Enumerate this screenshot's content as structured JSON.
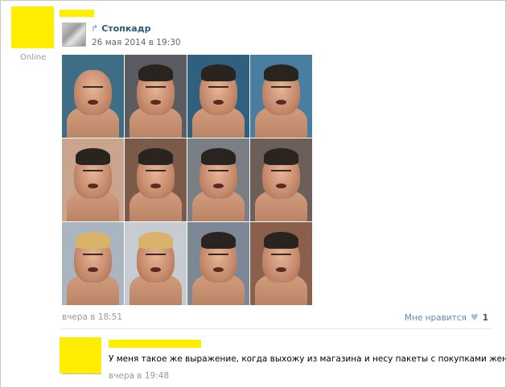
{
  "post": {
    "status": "Online",
    "repost": {
      "source_name": "Стопкадр",
      "date": "26 мая 2014 в 19:30",
      "icon": "repost-arrow-icon"
    },
    "photo_count": 12,
    "footer": {
      "date": "вчера в 18:51",
      "like_label": "Мне нравится",
      "like_icon": "heart-icon",
      "like_count": "1"
    }
  },
  "comment": {
    "text": "У меня такое же выражение, когда выхожу из магазина и несу пакеты с покупками жены.",
    "date": "вчера в 19:48"
  },
  "colors": {
    "redaction": "#ffee00",
    "link": "#2b587a",
    "muted": "#999999"
  }
}
